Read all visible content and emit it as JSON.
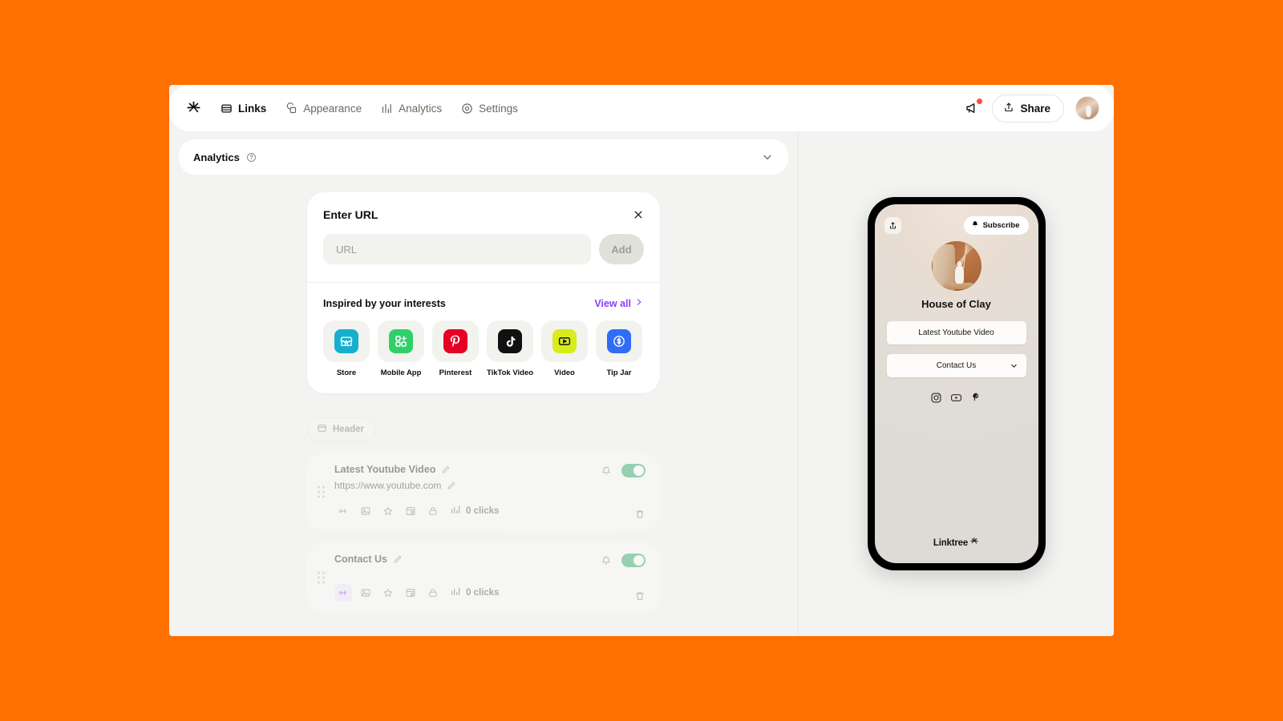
{
  "background_color": "#ff7000",
  "topnav": {
    "logo_icon": "linktree-asterisk-icon",
    "items": [
      {
        "label": "Links",
        "icon": "links-list-icon",
        "active": true
      },
      {
        "label": "Appearance",
        "icon": "appearance-copy-icon",
        "active": false
      },
      {
        "label": "Analytics",
        "icon": "analytics-bars-icon",
        "active": false
      },
      {
        "label": "Settings",
        "icon": "settings-gear-icon",
        "active": false
      }
    ],
    "megaphone_icon": "megaphone-icon",
    "has_notification": true,
    "share_label": "Share",
    "share_icon": "share-upload-icon",
    "avatar_icon": "user-avatar"
  },
  "analytics_strip": {
    "label": "Analytics",
    "help_icon": "question-circle-icon",
    "chevron_icon": "chevron-down-icon"
  },
  "add_link_card": {
    "title": "Enter URL",
    "close_icon": "close-icon",
    "url_placeholder": "URL",
    "url_value": "",
    "add_label": "Add",
    "inspired_title": "Inspired by your interests",
    "view_all_label": "View all",
    "view_all_chevron": "chevron-right-icon",
    "interests": [
      {
        "label": "Store",
        "icon": "storefront-icon",
        "color": "#16b0cd"
      },
      {
        "label": "Mobile App",
        "icon": "app-grid-plus-icon",
        "color": "#2fd06a"
      },
      {
        "label": "Pinterest",
        "icon": "pinterest-icon",
        "color": "#e60023"
      },
      {
        "label": "TikTok Video",
        "icon": "tiktok-icon",
        "color": "#111111"
      },
      {
        "label": "Video",
        "icon": "video-play-icon",
        "color": "#d7ec1a"
      },
      {
        "label": "Tip Jar",
        "icon": "tip-jar-dollar-icon",
        "color": "#2f6df6"
      }
    ]
  },
  "link_list": {
    "header_chip_label": "Header",
    "header_chip_icon": "header-block-icon",
    "rows": [
      {
        "title": "Latest Youtube Video",
        "url": "https://www.youtube.com",
        "clicks_label": "0 clicks",
        "toggle_on": true,
        "first_action_highlighted": false,
        "actions": [
          "share-forward-icon",
          "image-icon",
          "star-icon",
          "layout-icon",
          "lock-icon"
        ],
        "analytics_icon": "analytics-bars-icon",
        "bell_icon": "bell-icon",
        "delete_icon": "trash-icon",
        "edit_icon": "pencil-icon"
      },
      {
        "title": "Contact Us",
        "url": "",
        "clicks_label": "0 clicks",
        "toggle_on": true,
        "first_action_highlighted": true,
        "actions": [
          "share-forward-icon",
          "image-icon",
          "star-icon",
          "layout-icon",
          "lock-icon"
        ],
        "analytics_icon": "analytics-bars-icon",
        "bell_icon": "bell-icon",
        "delete_icon": "trash-icon",
        "edit_icon": "pencil-icon"
      }
    ]
  },
  "preview": {
    "share_icon": "share-upload-icon",
    "subscribe_label": "Subscribe",
    "subscribe_icon": "bell-icon",
    "profile_name": "House of Clay",
    "avatar_icon": "profile-photo",
    "links": [
      {
        "label": "Latest Youtube Video",
        "has_chevron": false
      },
      {
        "label": "Contact Us",
        "has_chevron": true
      }
    ],
    "socials": [
      {
        "name": "instagram-icon"
      },
      {
        "name": "youtube-icon"
      },
      {
        "name": "pinterest-icon"
      }
    ],
    "footer_label": "Linktree",
    "footer_icon": "linktree-asterisk-icon"
  },
  "colors": {
    "accent_purple": "#8b3dff",
    "toggle_green": "#19a05b",
    "notification_red": "#ff4d3d"
  }
}
